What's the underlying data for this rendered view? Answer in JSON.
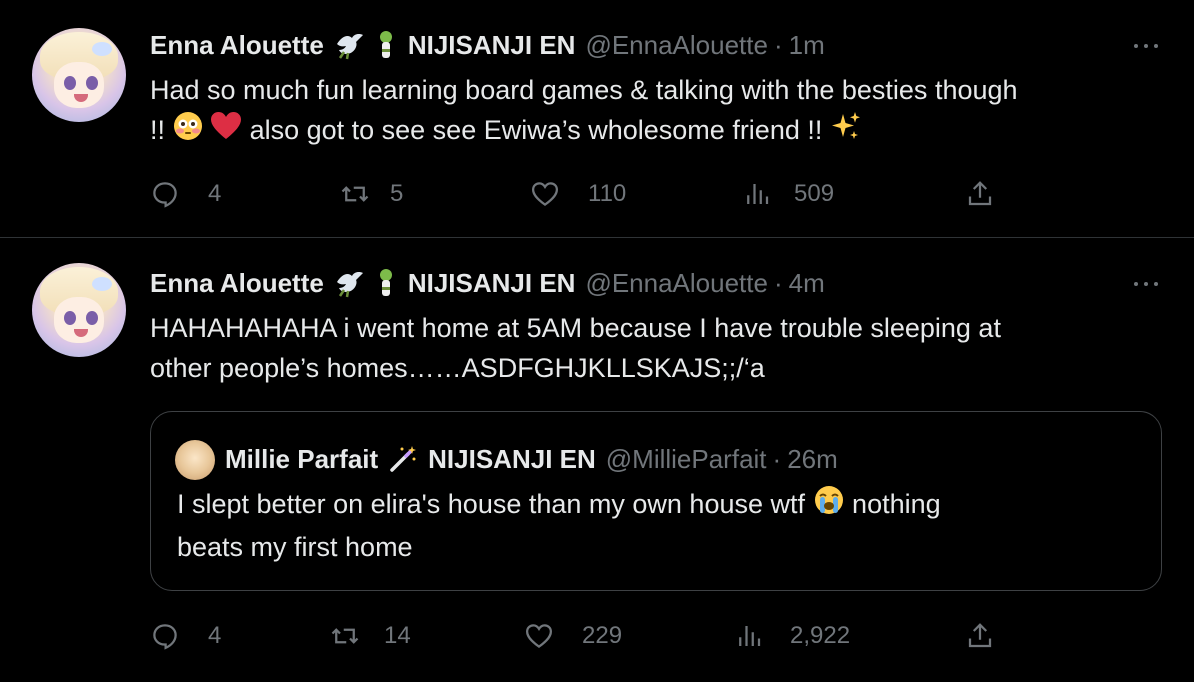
{
  "tweets": [
    {
      "author": {
        "name": "Enna Alouette",
        "badge_icons": [
          "dove-icon",
          "penlight-icon"
        ],
        "org": "NIJISANJI EN",
        "handle": "@EnnaAlouette",
        "separator": "·",
        "time": "1m"
      },
      "text": {
        "line1": "Had so much fun learning board games & talking with the besties though",
        "line2_pre": "!!",
        "line2_post": "also got to see see Ewiwa’s wholesome friend !!",
        "emojis": [
          "flushed-face-emoji",
          "red-heart-emoji",
          "sparkles-emoji"
        ]
      },
      "actions": {
        "replies": "4",
        "retweets": "5",
        "likes": "110",
        "views": "509"
      }
    },
    {
      "author": {
        "name": "Enna Alouette",
        "badge_icons": [
          "dove-icon",
          "penlight-icon"
        ],
        "org": "NIJISANJI EN",
        "handle": "@EnnaAlouette",
        "separator": "·",
        "time": "4m"
      },
      "text": {
        "line1": "HAHAHAHAHA i went home at 5AM because I have trouble sleeping at",
        "line2": "other people’s homes……ASDFGHJKLLSKAJS;;/‘a"
      },
      "quote": {
        "name": "Millie Parfait",
        "badge_icons": [
          "magic-wand-icon"
        ],
        "org": "NIJISANJI EN",
        "handle": "@MillieParfait",
        "separator": "·",
        "time": "26m",
        "line1_pre": "I slept better on elira's house than my own house wtf",
        "line1_post": "nothing",
        "line2": "beats my first home",
        "emojis": [
          "loudly-crying-face-emoji"
        ]
      },
      "actions": {
        "replies": "4",
        "retweets": "14",
        "likes": "229",
        "views": "2,922"
      }
    }
  ],
  "colors": {
    "background": "#000000",
    "text": "#e7e9ea",
    "muted": "#71767b",
    "divider": "#2f3336"
  }
}
